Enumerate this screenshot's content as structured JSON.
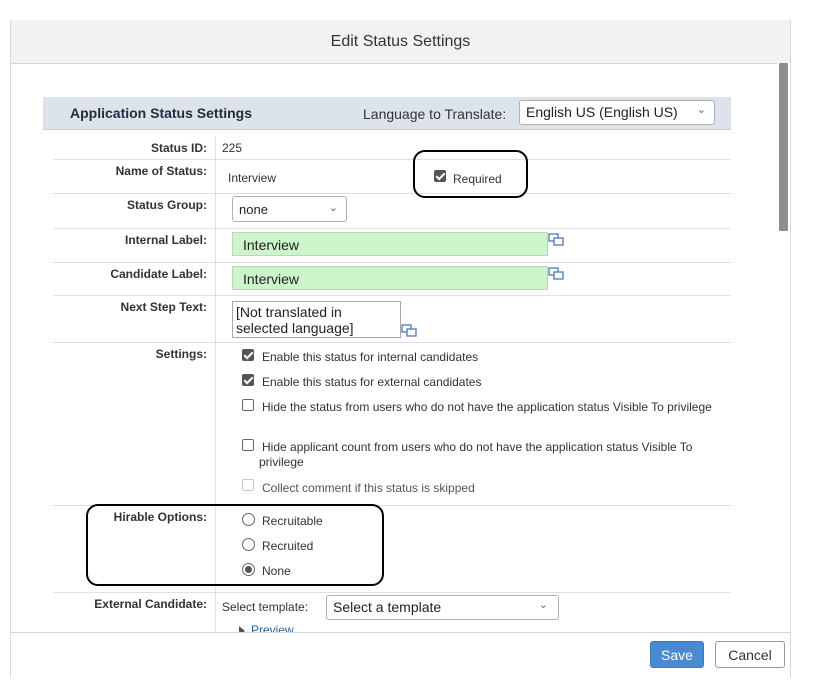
{
  "dialog": {
    "title": "Edit Status Settings"
  },
  "section": {
    "title": "Application Status Settings",
    "language_label": "Language to Translate:",
    "language_value": "English US (English US)"
  },
  "form": {
    "status_id": {
      "label": "Status ID:",
      "value": "225"
    },
    "name_of_status": {
      "label": "Name of Status:",
      "value": "Interview",
      "required_label": "Required",
      "required_checked": true
    },
    "status_group": {
      "label": "Status Group:",
      "value": "none"
    },
    "internal_label": {
      "label": "Internal Label:",
      "value": "Interview"
    },
    "candidate_label": {
      "label": "Candidate Label:",
      "value": "Interview"
    },
    "next_step_text": {
      "label": "Next Step Text:",
      "value": "[Not translated in selected language]"
    },
    "settings": {
      "label": "Settings:",
      "options": [
        {
          "text": "Enable this status for internal candidates",
          "checked": true
        },
        {
          "text": "Enable this status for external candidates",
          "checked": true
        },
        {
          "text": "Hide the status from users who do not have the application status Visible To privilege",
          "checked": false
        },
        {
          "text": "Hide applicant count from users who do not have the application status Visible To privilege",
          "checked": false
        },
        {
          "text": "Collect comment if this status is skipped",
          "checked": false,
          "disabled": true
        }
      ]
    },
    "hirable_options": {
      "label": "Hirable Options:",
      "options": [
        {
          "text": "Recruitable",
          "selected": false
        },
        {
          "text": "Recruited",
          "selected": false
        },
        {
          "text": "None",
          "selected": true
        }
      ]
    },
    "external_candidate": {
      "label": "External Candidate:",
      "select_template_label": "Select template:",
      "template_value": "Select a template",
      "preview_link": "Preview"
    }
  },
  "footer": {
    "save_label": "Save",
    "cancel_label": "Cancel"
  },
  "colors": {
    "primary_button": "#4a8ad2",
    "label_input_bg": "#ccf5cc",
    "section_bar": "#dde3ea"
  }
}
